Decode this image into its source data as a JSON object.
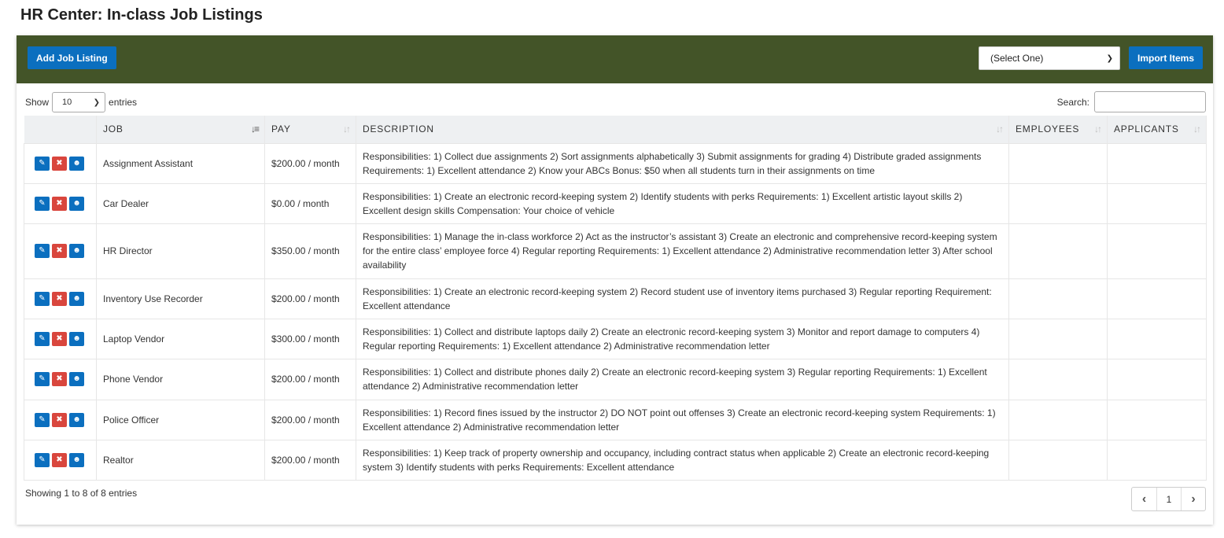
{
  "page": {
    "title": "HR Center: In-class Job Listings"
  },
  "toolbar": {
    "add_label": "Add Job Listing",
    "select_value": "(Select One)",
    "import_label": "Import Items",
    "bg_color": "#435428",
    "button_color": "#0b6fbf"
  },
  "controls": {
    "show_label": "Show",
    "entries_value": "10",
    "entries_label": "entries",
    "search_label": "Search:"
  },
  "table": {
    "columns": [
      "JOB",
      "PAY",
      "DESCRIPTION",
      "EMPLOYEES",
      "APPLICANTS"
    ],
    "rows": [
      {
        "job": "Assignment Assistant",
        "pay": "$200.00 / month",
        "description": "Responsibilities: 1) Collect due assignments 2) Sort assignments alphabetically 3) Submit assignments for grading 4) Distribute graded assignments Requirements: 1) Excellent attendance 2) Know your ABCs Bonus: $50 when all students turn in their assignments on time",
        "employees": "",
        "applicants": ""
      },
      {
        "job": "Car Dealer",
        "pay": "$0.00 / month",
        "description": "Responsibilities: 1) Create an electronic record-keeping system 2) Identify students with perks Requirements: 1) Excellent artistic layout skills 2) Excellent design skills Compensation: Your choice of vehicle",
        "employees": "",
        "applicants": ""
      },
      {
        "job": "HR Director",
        "pay": "$350.00 / month",
        "description": "Responsibilities: 1) Manage the in-class workforce 2) Act as the instructor’s assistant 3) Create an electronic and comprehensive record-keeping system for the entire class’ employee force 4) Regular reporting Requirements: 1) Excellent attendance 2) Administrative recommendation letter 3) After school availability",
        "employees": "",
        "applicants": ""
      },
      {
        "job": "Inventory Use Recorder",
        "pay": "$200.00 / month",
        "description": "Responsibilities: 1) Create an electronic record-keeping system 2) Record student use of inventory items purchased 3) Regular reporting Requirement: Excellent attendance",
        "employees": "",
        "applicants": ""
      },
      {
        "job": "Laptop Vendor",
        "pay": "$300.00 / month",
        "description": "Responsibilities: 1) Collect and distribute laptops daily 2) Create an electronic record-keeping system 3) Monitor and report damage to computers 4) Regular reporting Requirements: 1) Excellent attendance 2) Administrative recommendation letter",
        "employees": "",
        "applicants": ""
      },
      {
        "job": "Phone Vendor",
        "pay": "$200.00 / month",
        "description": "Responsibilities: 1) Collect and distribute phones daily 2) Create an electronic record-keeping system 3) Regular reporting Requirements: 1) Excellent attendance 2) Administrative recommendation letter",
        "employees": "",
        "applicants": ""
      },
      {
        "job": "Police Officer",
        "pay": "$200.00 / month",
        "description": "Responsibilities: 1) Record fines issued by the instructor 2) DO NOT point out offenses 3) Create an electronic record-keeping system Requirements: 1) Excellent attendance 2) Administrative recommendation letter",
        "employees": "",
        "applicants": ""
      },
      {
        "job": "Realtor",
        "pay": "$200.00 / month",
        "description": "Responsibilities: 1) Keep track of property ownership and occupancy, including contract status when applicable 2) Create an electronic record-keeping system 3) Identify students with perks Requirements: Excellent attendance",
        "employees": "",
        "applicants": ""
      }
    ]
  },
  "footer": {
    "info": "Showing 1 to 8 of 8 entries",
    "current_page": "1"
  }
}
